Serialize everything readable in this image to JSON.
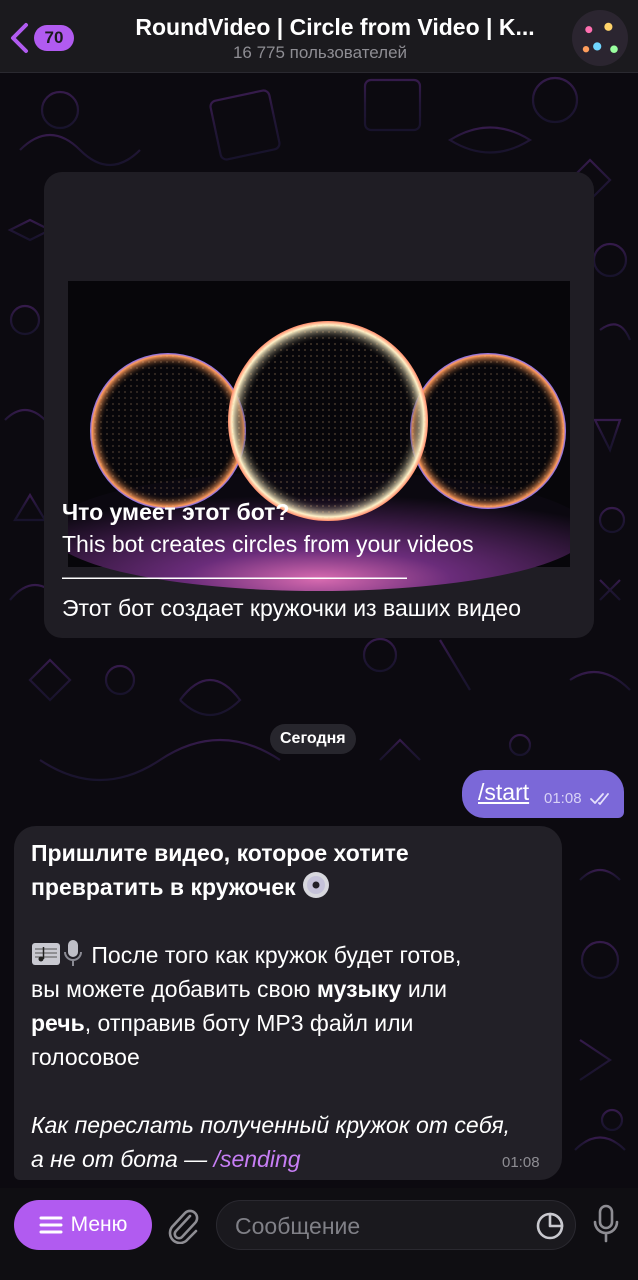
{
  "header": {
    "unread_count": "70",
    "title": "RoundVideo | Circle from Video | K...",
    "subtitle": "16 775 пользователей"
  },
  "bot_info": {
    "heading": "Что умеет этот бот?",
    "line_en": "This bot creates circles from your videos",
    "divider": "———————————————",
    "line_ru": "Этот бот создает кружочки из ваших видео"
  },
  "date_separator": "Сегодня",
  "outgoing": {
    "text": "/start",
    "time": "01:08"
  },
  "incoming": {
    "heading_line1": "Пришлите видео, которое хотите",
    "heading_line2": "превратить в кружочек",
    "p1_a": "После того как кружок будет готов,",
    "p1_b": "вы можете добавить свою",
    "p1_bold1": "музыку",
    "p1_c": "или",
    "p1_bold2": "речь",
    "p1_d": ", отправив боту MP3 файл или",
    "p1_e": "голосовое",
    "italic_1": "Как переслать полученный кружок от себя,",
    "italic_2": "а не от бота —",
    "link": "/sending",
    "time": "01:08"
  },
  "composer": {
    "menu_label": "Меню",
    "placeholder": "Сообщение"
  },
  "colors": {
    "accent": "#b15bf0",
    "outgoing_bubble": "#7b68d8",
    "incoming_bubble": "#222027",
    "background": "#0c0a10"
  },
  "icons": [
    "back-chevron-icon",
    "paperclip-icon",
    "sticker-icon",
    "microphone-icon",
    "double-check-icon",
    "menu-lines-icon",
    "disc-icon",
    "music-score-icon"
  ]
}
